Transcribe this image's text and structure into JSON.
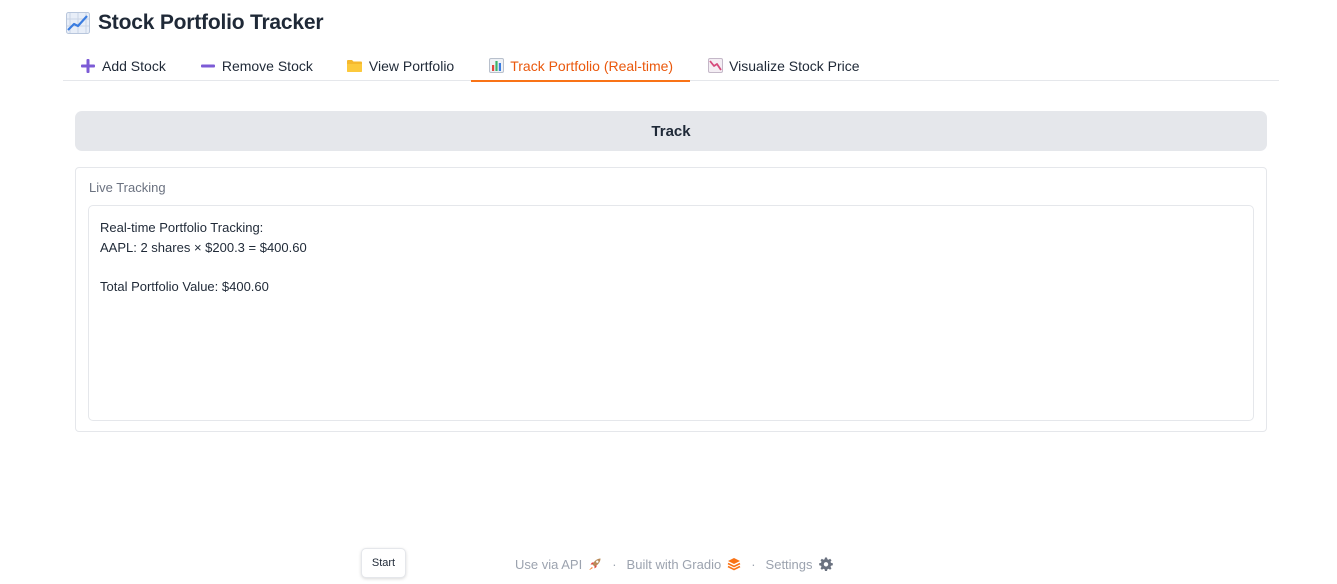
{
  "app": {
    "title": "Stock Portfolio Tracker",
    "title_icon": "chart-increasing-icon"
  },
  "tabs": [
    {
      "label": "Add Stock",
      "icon": "plus-icon",
      "active": false
    },
    {
      "label": "Remove Stock",
      "icon": "minus-icon",
      "active": false
    },
    {
      "label": "View Portfolio",
      "icon": "folder-icon",
      "active": false
    },
    {
      "label": "Track Portfolio (Real-time)",
      "icon": "bar-chart-icon",
      "active": true
    },
    {
      "label": "Visualize Stock Price",
      "icon": "chart-decreasing-icon",
      "active": false
    }
  ],
  "track": {
    "button_label": "Track",
    "output_label": "Live Tracking",
    "output_text": "Real-time Portfolio Tracking:\nAAPL: 2 shares × $200.3 = $400.60\n\nTotal Portfolio Value: $400.60"
  },
  "floating": {
    "start_label": "Start"
  },
  "footer": {
    "api_label": "Use via API",
    "gradio_label": "Built with Gradio",
    "settings_label": "Settings",
    "separator": "·"
  },
  "colors": {
    "accent": "#f97316",
    "accent_text": "#ea580c",
    "button_bg": "#e5e7eb",
    "border": "#e5e7eb",
    "muted_text": "#9ca3af"
  }
}
